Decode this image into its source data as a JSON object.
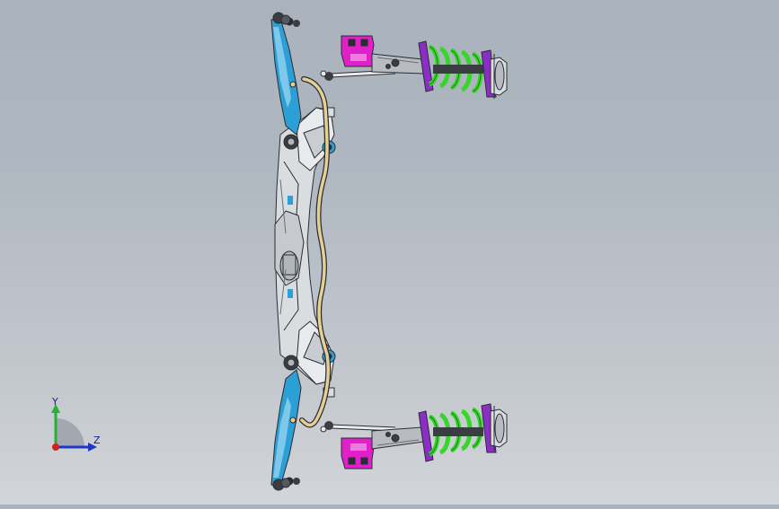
{
  "viewport": {
    "background_top": "#aab3bd",
    "background_bottom": "#d2d5d9",
    "model_colors": {
      "frame_blue": "#2c9fd6",
      "frame_light": "#d9dde0",
      "stabilizer_bar": "#e6cf94",
      "spring_green": "#37d62a",
      "mount_magenta": "#e020c8",
      "damper_gray": "#b8bcc2",
      "outline": "#2a2d33"
    }
  },
  "triad": {
    "y_label": "Y",
    "z_label": "Z",
    "y_color": "#27b035",
    "z_color": "#2136c8",
    "origin_color": "#d42020"
  }
}
